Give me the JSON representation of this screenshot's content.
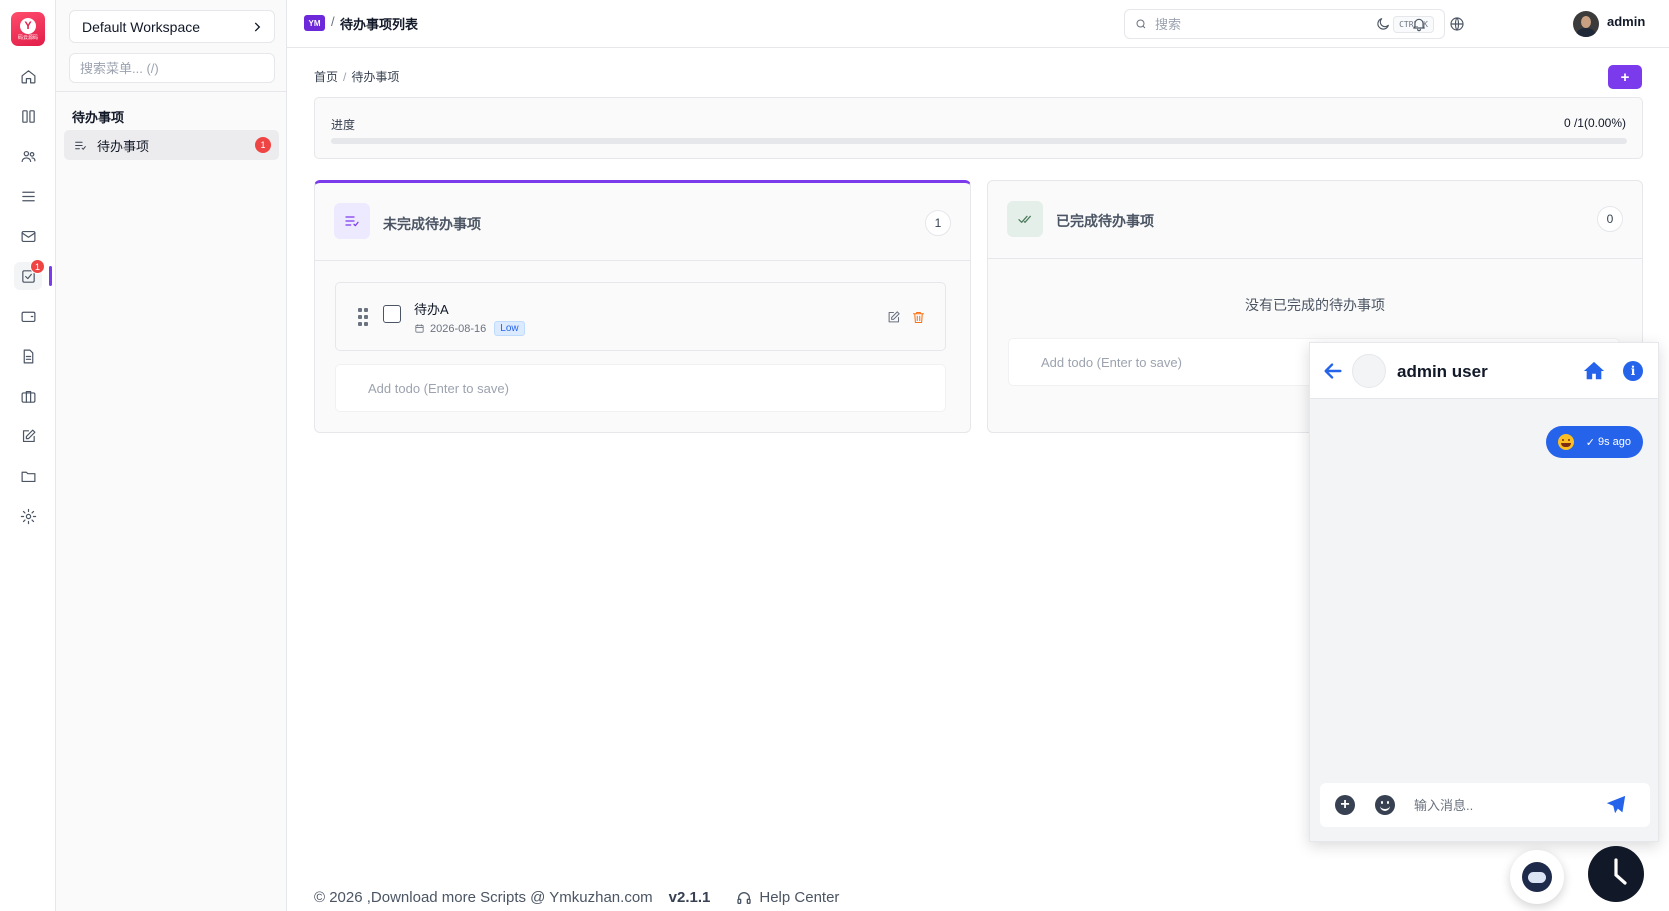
{
  "logo": {
    "caption": "码云源码"
  },
  "rail": {
    "items": [
      {
        "icon": "home-icon"
      },
      {
        "icon": "columns-icon"
      },
      {
        "icon": "users-icon"
      },
      {
        "icon": "menu-lines-icon"
      },
      {
        "icon": "mail-icon"
      },
      {
        "icon": "todo-check-icon",
        "badge": "1",
        "active": true
      },
      {
        "icon": "wallet-icon"
      },
      {
        "icon": "file-text-icon"
      },
      {
        "icon": "briefcase-icon"
      },
      {
        "icon": "edit-icon"
      },
      {
        "icon": "folder-icon"
      },
      {
        "icon": "settings-icon"
      }
    ]
  },
  "menu": {
    "workspace": "Default Workspace",
    "search_placeholder": "搜索菜单... (/)",
    "group_title": "待办事项",
    "items": [
      {
        "label": "待办事项",
        "badge": "1",
        "icon": "list-check-icon"
      }
    ]
  },
  "header": {
    "app_tag": "YM",
    "separator": "/",
    "title": "待办事项列表",
    "search_placeholder": "搜索",
    "shortcut": "CTRL K",
    "user_name": "admin"
  },
  "breadcrumb": {
    "home": "首页",
    "separator": "/",
    "current": "待办事项"
  },
  "add_button": "+",
  "progress": {
    "label": "进度",
    "value_text": "0 /1(0.00%)",
    "fraction": 0.0
  },
  "columns": {
    "pending": {
      "title": "未完成待办事项",
      "count": "1",
      "todos": [
        {
          "name": "待办A",
          "date": "2026-08-16",
          "priority": "Low"
        }
      ],
      "add_placeholder": "Add todo (Enter to save)"
    },
    "done": {
      "title": "已完成待办事项",
      "count": "0",
      "empty": "没有已完成的待办事项",
      "add_placeholder": "Add todo (Enter to save)"
    }
  },
  "footer": {
    "copyright": "© 2026 ,Download more Scripts @ Ymkuzhan.com",
    "version": "v2.1.1",
    "help": "Help Center"
  },
  "chat": {
    "name": "admin user",
    "message_time": "9s ago",
    "input_placeholder": "输入消息..",
    "accent": "#2563eb"
  },
  "colors": {
    "accent": "#7c3aed",
    "danger": "#ef4444",
    "chat_blue": "#2563eb"
  }
}
